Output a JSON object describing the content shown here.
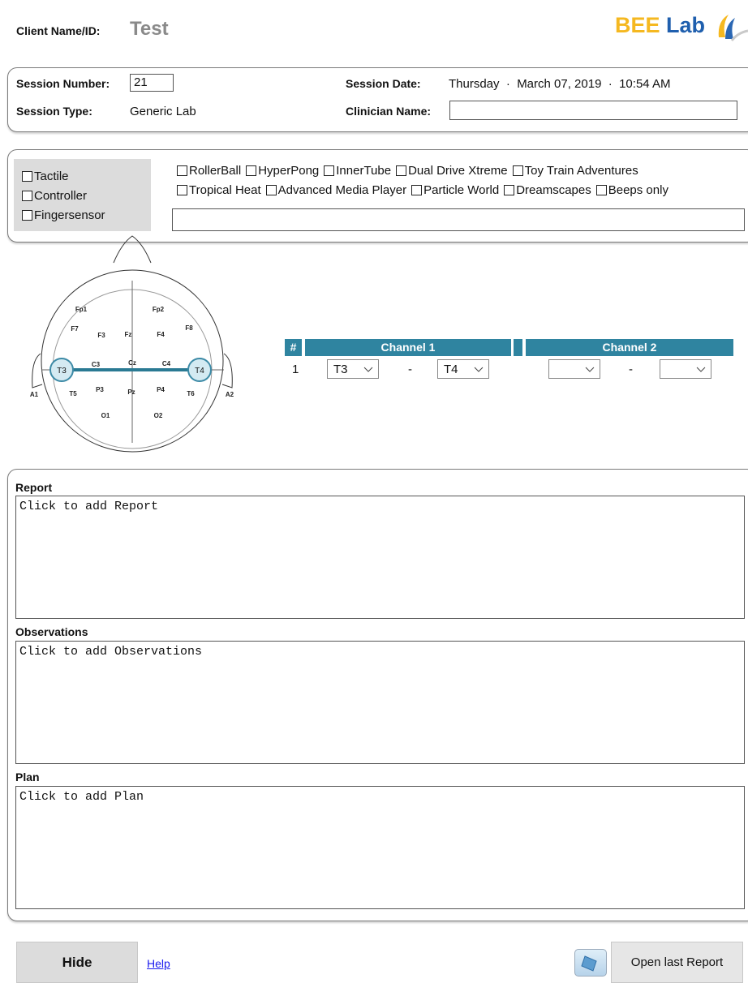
{
  "header": {
    "client_label": "Client Name/ID:",
    "client_value": "Test",
    "logo_text_bee": "BEE",
    "logo_text_lab": "Lab"
  },
  "session": {
    "number_label": "Session Number:",
    "number_value": "21",
    "type_label": "Session Type:",
    "type_value": "Generic Lab",
    "date_label": "Session Date:",
    "date_value": "Thursday  ·  March 07, 2019  ·  10:54 AM",
    "clinician_label": "Clinician Name:",
    "clinician_value": ""
  },
  "modalities": [
    {
      "label": "Tactile",
      "checked": false
    },
    {
      "label": "Controller",
      "checked": false
    },
    {
      "label": "Fingersensor",
      "checked": false
    }
  ],
  "games_row1": [
    {
      "label": "RollerBall",
      "checked": false
    },
    {
      "label": "HyperPong",
      "checked": false
    },
    {
      "label": "InnerTube",
      "checked": false
    },
    {
      "label": "Dual Drive Xtreme",
      "checked": false
    },
    {
      "label": "Toy Train Adventures",
      "checked": false
    }
  ],
  "games_row2": [
    {
      "label": "Tropical Heat",
      "checked": false
    },
    {
      "label": "Advanced Media Player",
      "checked": false
    },
    {
      "label": "Particle World",
      "checked": false
    },
    {
      "label": "Dreamscapes",
      "checked": false
    },
    {
      "label": "Beeps only",
      "checked": false
    }
  ],
  "games_other_value": "",
  "eeg_map": {
    "sites": [
      "Fp1",
      "Fp2",
      "F7",
      "F3",
      "Fz",
      "F4",
      "F8",
      "T3",
      "C3",
      "Cz",
      "C4",
      "T4",
      "T5",
      "P3",
      "Pz",
      "P4",
      "T6",
      "O1",
      "O2",
      "A1",
      "A2"
    ],
    "selected_active": "T3",
    "selected_reference": "T4"
  },
  "channels": {
    "hash_label": "#",
    "channel1_label": "Channel 1",
    "channel2_label": "Channel 2",
    "rows": [
      {
        "num": "1",
        "ch1_active": "T3",
        "ch1_ref": "T4",
        "ch2_active": "",
        "ch2_ref": "",
        "dash": "-"
      }
    ]
  },
  "notes": {
    "report_label": "Report",
    "report_placeholder": "Click to add Report",
    "observations_label": "Observations",
    "observations_placeholder": "Click to add Observations",
    "plan_label": "Plan",
    "plan_placeholder": "Click to add Plan"
  },
  "footer": {
    "hide_label": "Hide",
    "help_label": "Help",
    "open_report_label": "Open last Report"
  },
  "colors": {
    "channel_header": "#2f84a0",
    "logo_bee": "#f5b820",
    "logo_lab": "#1f5fae",
    "link": "#1a1aee"
  }
}
